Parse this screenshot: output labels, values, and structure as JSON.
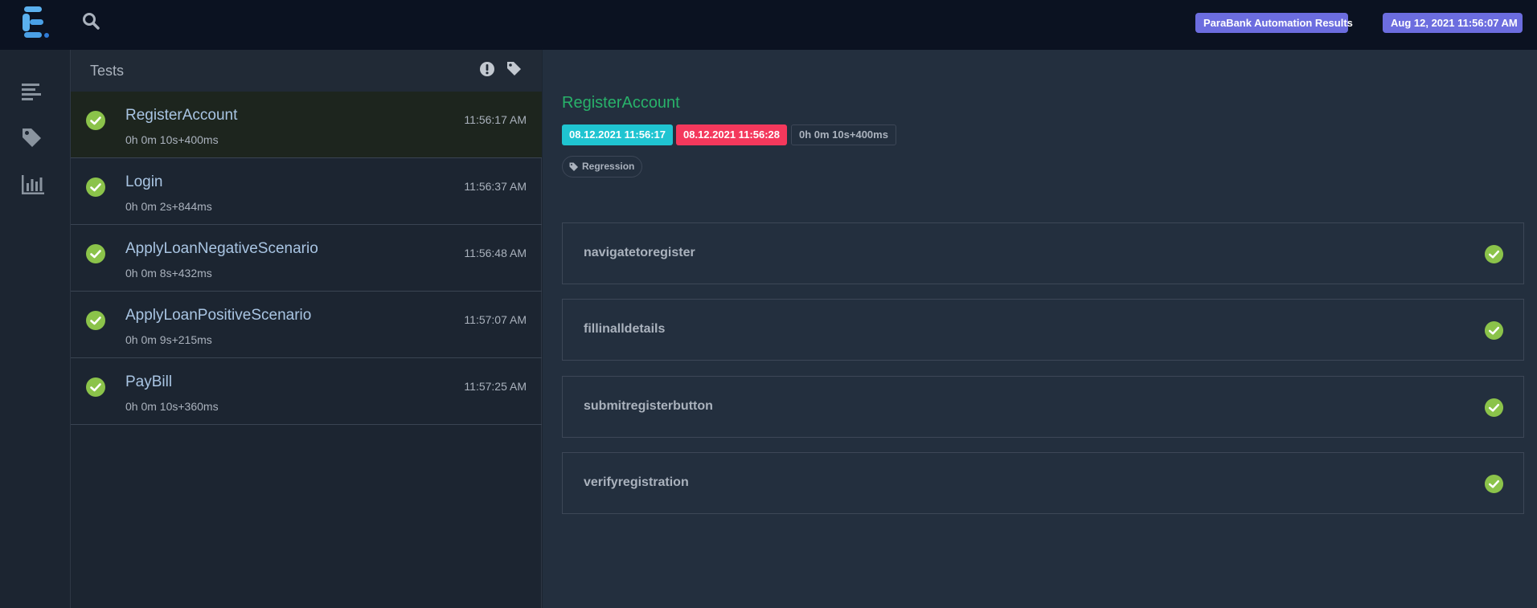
{
  "header": {
    "report_name": "ParaBank Automation Results",
    "report_date": "Aug 12, 2021 11:56:07 AM",
    "accent_color": "#6c6ddf",
    "background_color": "#0b1221"
  },
  "nav": {
    "items": [
      {
        "icon": "list-icon"
      },
      {
        "icon": "tag-icon"
      },
      {
        "icon": "bar-chart-icon"
      }
    ]
  },
  "tests": {
    "header_title": "Tests",
    "header_icons": [
      "exclamation-circle-icon",
      "tag-icon"
    ],
    "items": [
      {
        "name": "RegisterAccount",
        "duration": "0h 0m 10s+400ms",
        "time": "11:56:17 AM",
        "status": "pass"
      },
      {
        "name": "Login",
        "duration": "0h 0m 2s+844ms",
        "time": "11:56:37 AM",
        "status": "pass"
      },
      {
        "name": "ApplyLoanNegativeScenario",
        "duration": "0h 0m 8s+432ms",
        "time": "11:56:48 AM",
        "status": "pass"
      },
      {
        "name": "ApplyLoanPositiveScenario",
        "duration": "0h 0m 9s+215ms",
        "time": "11:57:07 AM",
        "status": "pass"
      },
      {
        "name": "PayBill",
        "duration": "0h 0m 10s+360ms",
        "time": "11:57:25 AM",
        "status": "pass"
      }
    ]
  },
  "detail": {
    "title": "RegisterAccount",
    "start_time": "08.12.2021 11:56:17",
    "end_time": "08.12.2021 11:56:28",
    "duration": "0h 0m 10s+400ms",
    "tag": "Regression",
    "steps": [
      {
        "name": "navigatetoregister",
        "status": "pass"
      },
      {
        "name": "fillinalldetails",
        "status": "pass"
      },
      {
        "name": "submitregisterbutton",
        "status": "pass"
      },
      {
        "name": "verifyregistration",
        "status": "pass"
      }
    ]
  },
  "colors": {
    "pass": "#8bc34a",
    "start_pill": "#1fc4d1",
    "end_pill": "#f4385c",
    "title_green": "#28b26a"
  }
}
